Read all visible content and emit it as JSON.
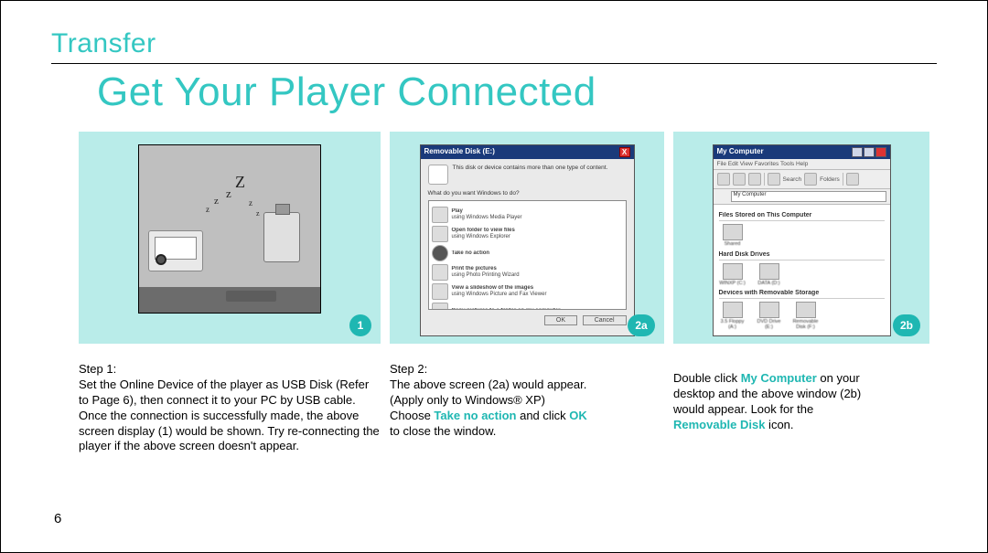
{
  "section_header": "Transfer",
  "title": "Get Your Player Connected",
  "page_number": "6",
  "badges": {
    "b1": "1",
    "b2a": "2a",
    "b2b": "2b"
  },
  "illus": {
    "z_vals": [
      "Z",
      "z",
      "z",
      "z",
      "z",
      "z"
    ]
  },
  "dialog2a": {
    "title": "Removable Disk (E:)",
    "blurb": "This disk or device contains more than one type of content.",
    "prompt": "What do you want Windows to do?",
    "rows": [
      {
        "t1": "Play",
        "t2": "using Windows Media Player"
      },
      {
        "t1": "Open folder to view files",
        "t2": "using Windows Explorer"
      },
      {
        "t1": "Take no action",
        "t2": ""
      },
      {
        "t1": "Print the pictures",
        "t2": "using Photo Printing Wizard"
      },
      {
        "t1": "View a slideshow of the images",
        "t2": "using Windows Picture and Fax Viewer"
      },
      {
        "t1": "Copy pictures to a folder on my computer",
        "t2": ""
      }
    ],
    "ok": "OK",
    "cancel": "Cancel"
  },
  "explorer2b": {
    "title": "My Computer",
    "menu": "File   Edit   View   Favorites   Tools   Help",
    "search": "Search",
    "folders": "Folders",
    "addr": "My Computer",
    "group1": "Files Stored on This Computer",
    "g1_items": [
      "Shared"
    ],
    "group2": "Hard Disk Drives",
    "g2_items": [
      "WINXP (C:)",
      "DATA (D:)"
    ],
    "group3": "Devices with Removable Storage",
    "g3_items": [
      "3.5 Floppy (A:)",
      "DVD Drive (E:)",
      "Removable Disk (F:)"
    ]
  },
  "step1": {
    "heading": "Step 1:",
    "body": "Set the Online Device of the player as USB Disk (Refer to Page 6), then connect it to your PC by USB cable. Once the connection is successfully made, the above screen display (1) would be shown. Try re-connecting the player if the above screen doesn't appear."
  },
  "step2": {
    "heading": "Step 2:",
    "line1": "The above screen (2a) would appear.",
    "line2": "(Apply only to Windows® XP)",
    "line3a": "Choose ",
    "line3h": "Take no action",
    "line3b": " and click ",
    "line3h2": "OK",
    "line4": "to close the window."
  },
  "step3": {
    "line1a": "Double click ",
    "line1h": "My Computer",
    "line1b": " on your",
    "line2": "desktop and the above window (2b)",
    "line3": "would appear. Look for the",
    "line4h": "Removable Disk",
    "line4b": " icon."
  }
}
